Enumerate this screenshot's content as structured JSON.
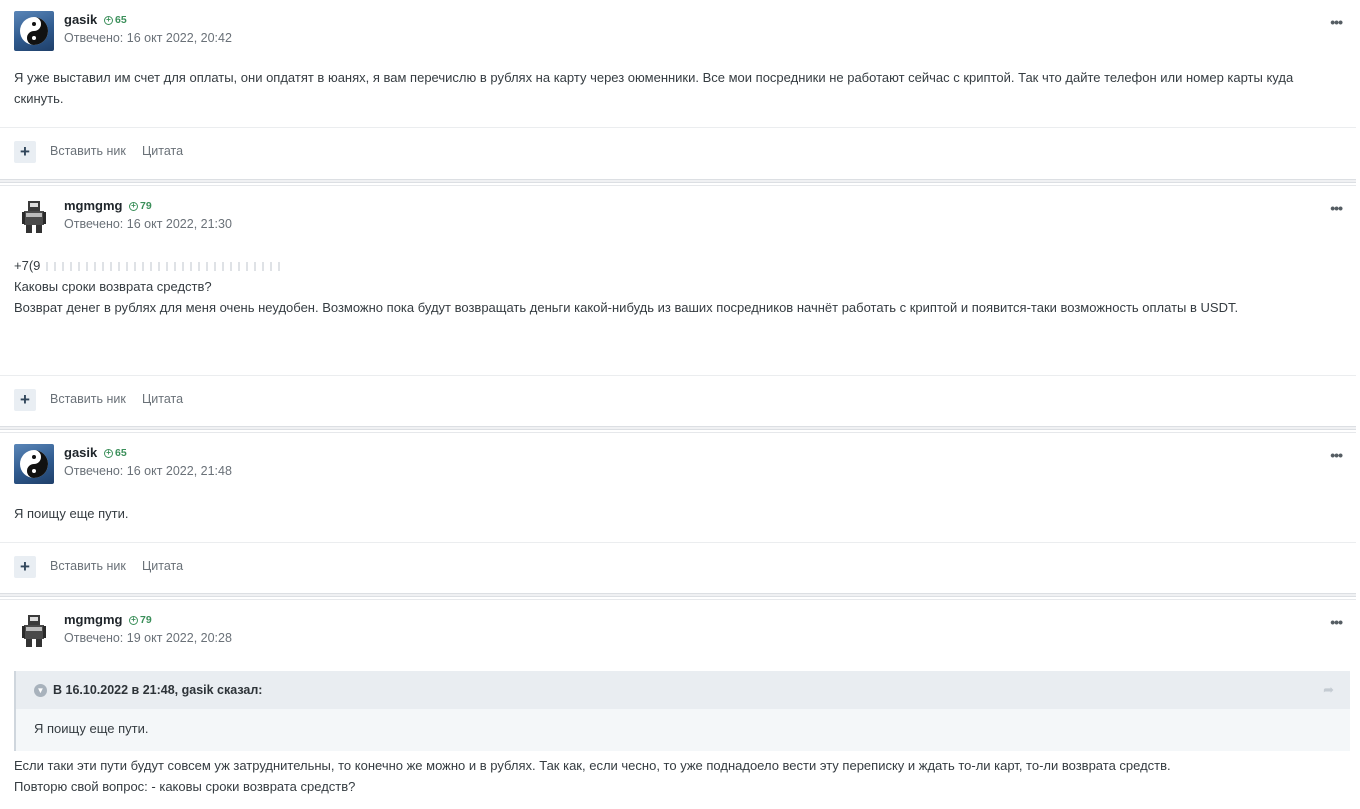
{
  "posts": [
    {
      "author": "gasik",
      "reputation": "65",
      "meta": "Отвечено: 16 окт 2022, 20:42",
      "avatar": "yin-yang-avatar",
      "lines": [
        "Я уже выставил им счет для оплаты, они опдатят в юанях, я вам перечислю в рублях на карту через оюменники. Все мои посредники не работают сейчас с криптой. Так что дайте телефон или номер карты куда скинуть."
      ]
    },
    {
      "author": "mgmgmg",
      "reputation": "79",
      "meta": "Отвечено: 16 окт 2022, 21:30",
      "avatar": "robot-avatar",
      "phone_fragment": "+7(9",
      "lines": [
        "Каковы сроки возврата средств?",
        "Возврат денег в рублях для меня очень неудобен. Возможно пока будут возвращать деньги какой-нибудь из ваших посредников начнёт работать с криптой и появится-таки возможность оплаты в USDT."
      ]
    },
    {
      "author": "gasik",
      "reputation": "65",
      "meta": "Отвечено: 16 окт 2022, 21:48",
      "avatar": "yin-yang-avatar",
      "lines": [
        "Я поищу еще пути."
      ]
    },
    {
      "author": "mgmgmg",
      "reputation": "79",
      "meta": "Отвечено: 19 окт 2022, 20:28",
      "avatar": "robot-avatar",
      "quote": {
        "header": "В 16.10.2022 в 21:48, gasik сказал:",
        "body": "Я поищу еще пути."
      },
      "lines": [
        "Если таки эти пути будут совсем уж затруднительны, то конечно же можно и в рублях. Так как, если чесно, то уже поднадоело вести эту переписку и ждать то-ли карт, то-ли возврата средств.",
        "Повторю свой вопрос: - каковы сроки возврата средств?"
      ]
    }
  ],
  "actions": {
    "plus": "+",
    "insert_nick": "Вставить ник",
    "quote": "Цитата",
    "menu": "•••"
  }
}
